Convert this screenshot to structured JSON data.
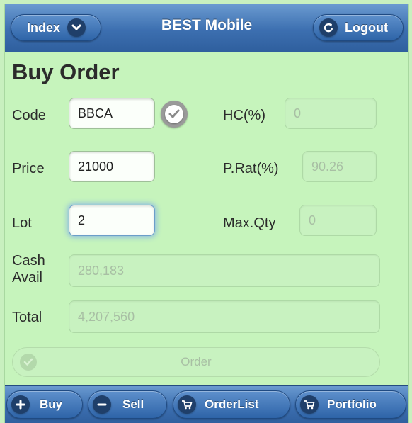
{
  "header": {
    "index_label": "Index",
    "app_title": "BEST Mobile",
    "logout_label": "Logout"
  },
  "page_title": "Buy Order",
  "form": {
    "code_label": "Code",
    "code_value": "BBCA",
    "hc_label": "HC(%)",
    "hc_value": "0",
    "price_label": "Price",
    "price_value": "21000",
    "prat_label": "P.Rat(%)",
    "prat_value": "90.26",
    "lot_label": "Lot",
    "lot_value": "2",
    "maxqty_label": "Max.Qty",
    "maxqty_value": "0",
    "cash_label_line1": "Cash",
    "cash_label_line2": "Avail",
    "cash_value": "280,183",
    "total_label": "Total",
    "total_value": "4,207,560",
    "order_label": "Order"
  },
  "footer": {
    "buy_label": "Buy",
    "sell_label": "Sell",
    "orderlist_label": "OrderList",
    "portfolio_label": "Portfolio"
  },
  "icons": {
    "index_icon": "chevron-down-icon",
    "logout_icon": "refresh-icon",
    "check_icon": "check-icon",
    "buy_icon": "plus-icon",
    "sell_icon": "minus-icon",
    "orderlist_icon": "cart-icon",
    "portfolio_icon": "cart-icon"
  },
  "colors": {
    "background": "#c6f4bc",
    "header_blue": "#3c6fb0",
    "focus_glow": "#8cb9e2"
  }
}
